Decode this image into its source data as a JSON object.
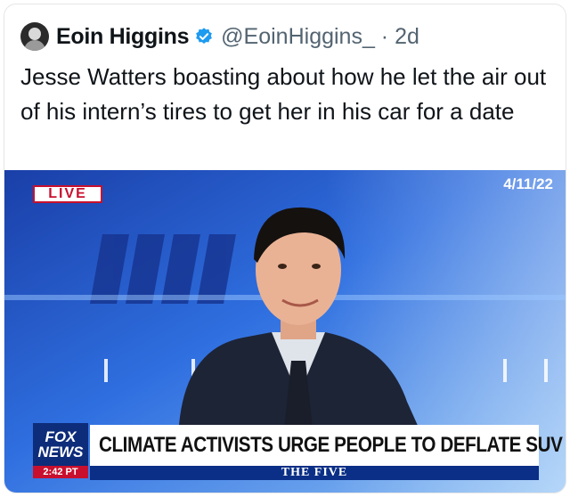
{
  "tweet": {
    "author_name": "Eoin Higgins",
    "handle_and_time": "@EoinHiggins_ · 2d",
    "text": "Jesse Watters boasting about how he let the air out of his intern’s tires to get her in his car for a date",
    "verified_icon": "verified-badge-icon",
    "accent_color": "#1d9bf0"
  },
  "broadcast": {
    "live_label": "LIVE",
    "date": "4/11/22",
    "logo_line1": "FOX",
    "logo_line2": "NEWS",
    "time": "2:42 PT",
    "headline": "CLIMATE ACTIVISTS URGE PEOPLE TO DEFLATE SUV TIRES",
    "show_name": "THE FIVE",
    "brand_color": "#0d2c7a",
    "alert_color": "#c8102e"
  }
}
